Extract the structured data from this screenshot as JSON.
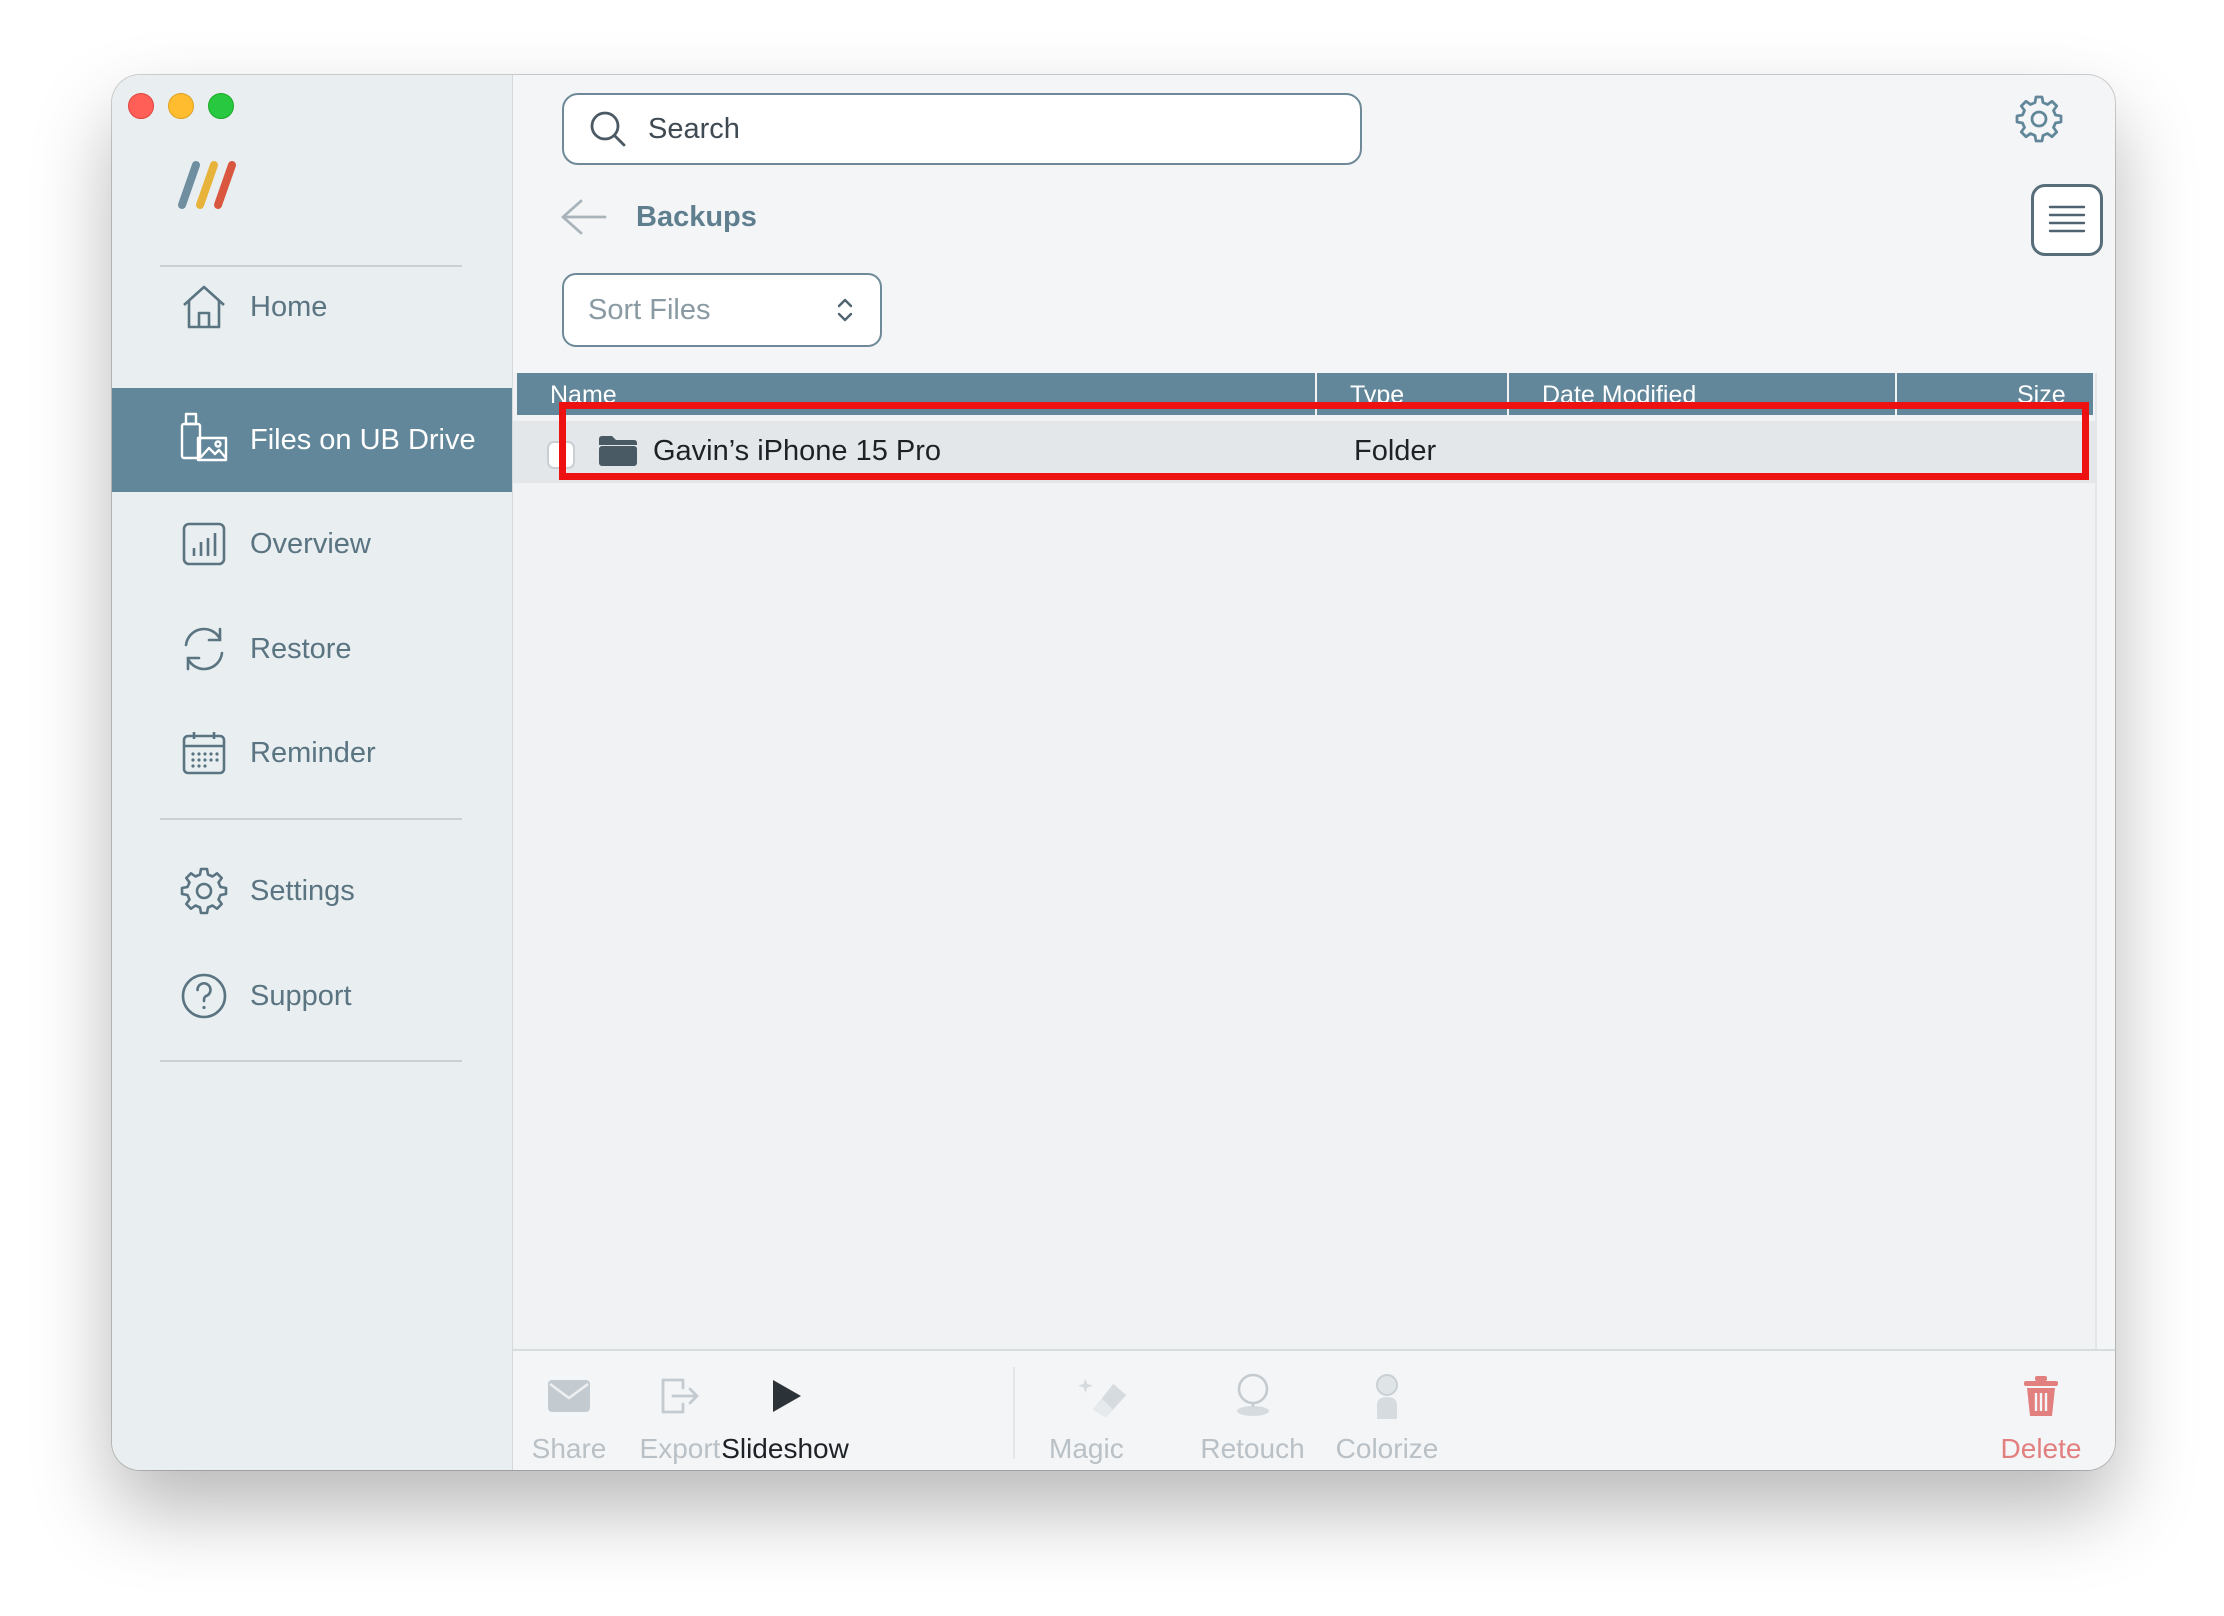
{
  "window": {
    "traffic_lights": [
      "close",
      "minimize",
      "zoom"
    ]
  },
  "sidebar": {
    "items": [
      {
        "label": "Home",
        "icon": "home-icon"
      },
      {
        "label": "Files on UB Drive",
        "icon": "drive-files-icon",
        "active": true
      },
      {
        "label": "Overview",
        "icon": "chart-icon"
      },
      {
        "label": "Restore",
        "icon": "restore-icon"
      },
      {
        "label": "Reminder",
        "icon": "calendar-icon"
      },
      {
        "label": "Settings",
        "icon": "gear-icon"
      },
      {
        "label": "Support",
        "icon": "question-icon"
      }
    ]
  },
  "header": {
    "search_placeholder": "Search",
    "breadcrumb": "Backups",
    "sort_label": "Sort Files",
    "view_mode": "list"
  },
  "table": {
    "columns": [
      "Name",
      "Type",
      "Date Modified",
      "Size"
    ],
    "rows": [
      {
        "name": "Gavin’s iPhone 15 Pro",
        "type": "Folder",
        "date_modified": "",
        "size": "",
        "highlighted": true
      }
    ]
  },
  "toolbar": {
    "share": "Share",
    "export": "Export",
    "slideshow": "Slideshow",
    "magic_erase": "Magic Erase",
    "retouch": "Retouch",
    "colorize": "Colorize",
    "delete": "Delete"
  },
  "colors": {
    "accent": "#62879a",
    "highlight_border": "#ee1111",
    "delete": "#e27f7f"
  }
}
